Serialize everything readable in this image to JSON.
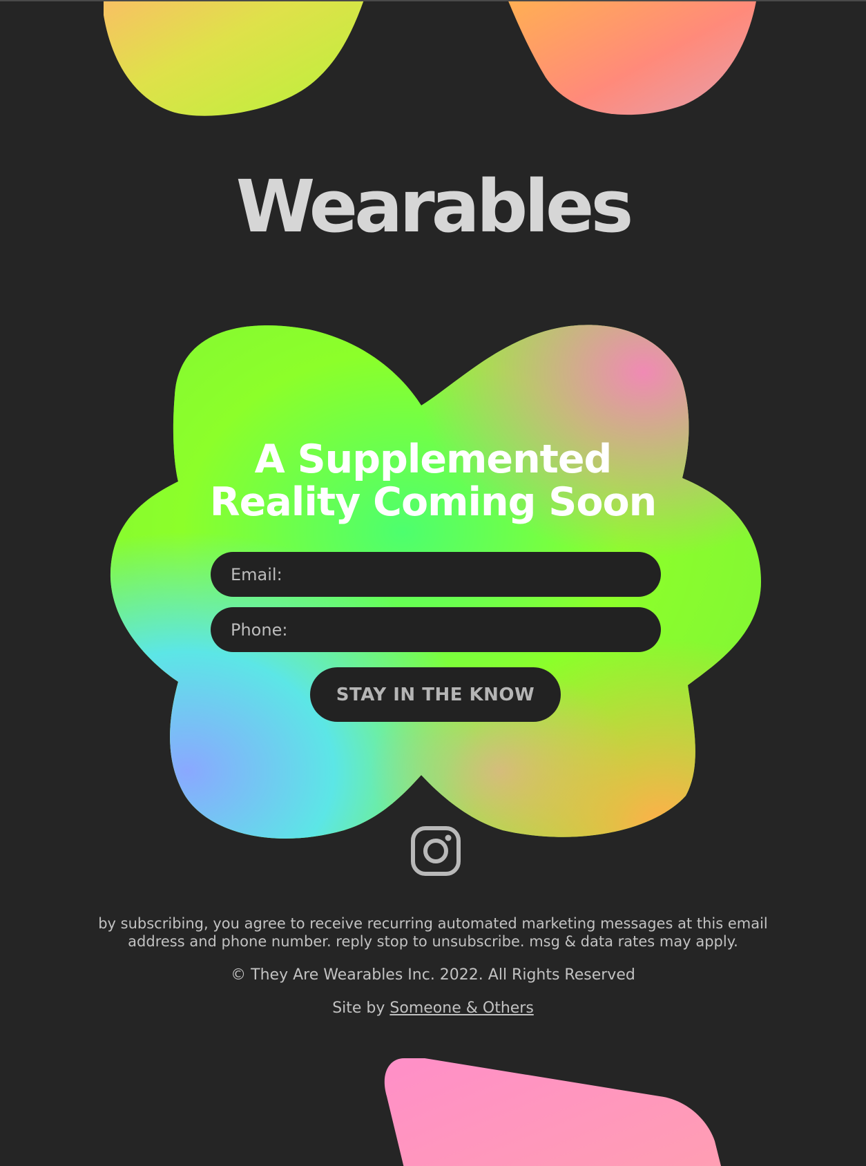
{
  "brand": {
    "logo_text": "Wearables"
  },
  "hero": {
    "headline_line1": "A Supplemented",
    "headline_line2": "Reality Coming Soon"
  },
  "form": {
    "email_placeholder": "Email:",
    "phone_placeholder": "Phone:",
    "submit_label": "STAY IN THE KNOW"
  },
  "social": {
    "icon": "instagram-icon"
  },
  "footer": {
    "disclaimer_line1": "by subscribing, you agree to receive recurring automated marketing messages at this email",
    "disclaimer_line2": "address and phone number. reply stop to unsubscribe. msg & data rates may apply.",
    "copyright": "© They Are Wearables Inc. 2022. All Rights Reserved",
    "credit_prefix": "Site by ",
    "credit_link": "Someone & Others"
  },
  "colors": {
    "background": "#252525",
    "input_background": "#222222",
    "text_muted": "#c2c2c2",
    "gradient_green": "#8cff2a",
    "gradient_pink": "#ff8fc0",
    "gradient_cyan": "#5ce6e6",
    "gradient_blue": "#8aa8ff",
    "gradient_orange": "#ffb04a"
  }
}
